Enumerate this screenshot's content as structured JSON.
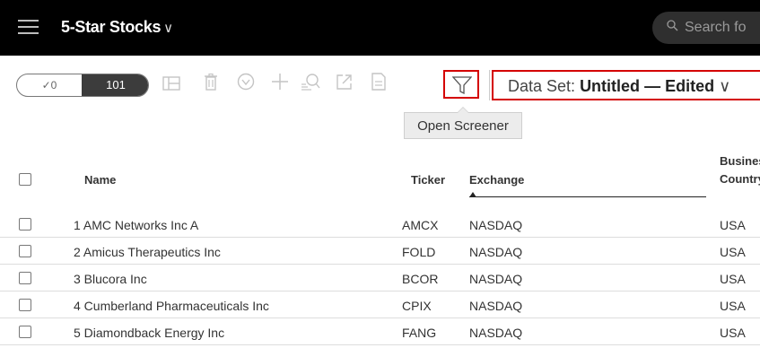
{
  "header": {
    "title": "5-Star Stocks",
    "title_chevron": "∨",
    "search_placeholder": "Search fo"
  },
  "toolbar": {
    "selected_count": "✓0",
    "total_count": "101",
    "dataset_label": "Data Set:",
    "dataset_name": "Untitled",
    "dataset_sep": "—",
    "dataset_status": "Edited",
    "dataset_chevron": "∨",
    "icons": [
      "columns-icon",
      "trash-icon",
      "check-circle-icon",
      "plus-icon",
      "search-list-icon",
      "export-icon",
      "document-icon",
      "filter-icon"
    ]
  },
  "tooltip": {
    "text": "Open Screener"
  },
  "table": {
    "headers": {
      "name": "Name",
      "ticker": "Ticker",
      "exchange": "Exchange",
      "business_country_1": "Busines",
      "business_country_2": "Country"
    },
    "rows": [
      {
        "name": "1 AMC Networks Inc A",
        "ticker": "AMCX",
        "exchange": "NASDAQ",
        "country": "USA"
      },
      {
        "name": "2 Amicus Therapeutics Inc",
        "ticker": "FOLD",
        "exchange": "NASDAQ",
        "country": "USA"
      },
      {
        "name": "3 Blucora Inc",
        "ticker": "BCOR",
        "exchange": "NASDAQ",
        "country": "USA"
      },
      {
        "name": "4 Cumberland Pharmaceuticals Inc",
        "ticker": "CPIX",
        "exchange": "NASDAQ",
        "country": "USA"
      },
      {
        "name": "5 Diamondback Energy Inc",
        "ticker": "FANG",
        "exchange": "NASDAQ",
        "country": "USA"
      }
    ]
  },
  "colors": {
    "header_bg": "#000000",
    "highlight": "#d40000",
    "toggle_active": "#3c3c3c"
  }
}
